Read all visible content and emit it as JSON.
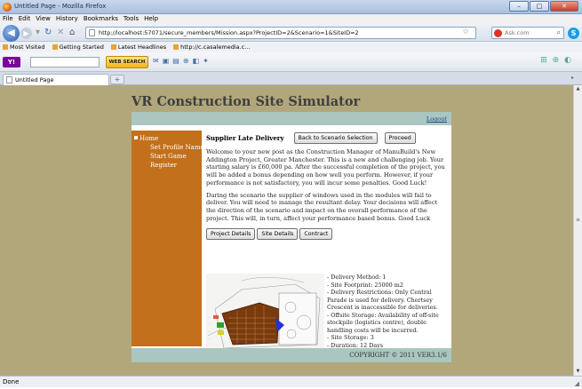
{
  "browser": {
    "window_title": "Untitled Page - Mozilla Firefox",
    "menu": [
      "File",
      "Edit",
      "View",
      "History",
      "Bookmarks",
      "Tools",
      "Help"
    ],
    "url": "http://localhost:57071/secure_members/Mission.aspx?ProjectID=2&Scenario=1&SiteID=2",
    "search_placeholder": "Ask.com",
    "bookmarks": [
      "Most Visited",
      "Getting Started",
      "Latest Headlines",
      "http://c.casalemedia.c..."
    ],
    "web_search_label": "WEB SEARCH",
    "tab_title": "Untitled Page",
    "status": "Done"
  },
  "page": {
    "site_title": "VR Construction Site Simulator",
    "logout": "Logout",
    "nav": [
      "Home",
      "Set Profile Name",
      "Start Game",
      "Register"
    ],
    "subtitle": "Supplier Late Delivery",
    "back_button": "Back to Scenario Selection",
    "proceed_button": "Proceed",
    "intro": "Welcome to your new post as the Construction Manager of ManuBuild's New Addington Project, Greater Manchester. This is a new and challenging job. Your starting salary is £60,000 pa. After the successful completion of the project, you will be added a bonus depending on how well you perform. However, if your performance is not satisfactory, you will incur some penalties. Good Luck!",
    "scenario": "During the scenario the supplier of windows used in the modules will fail to deliver. You will need to manage the resultant delay. Your decisions will affect the direction of the scenario and impact on the overall performance of the project. This will, in turn, affect your performance based bonus. Good Luck",
    "tabs": [
      "Project Details",
      "Site Details",
      "Contract"
    ],
    "details": [
      "- Delivery Method: 1",
      "- Site Footprint: 25000 m2",
      "- Delivery Restrictions: Only Central Parade is used for delivery. Chertsey Crescent is inaccessible for deliveries.",
      "- Offsite Storage: Availability of off-site stockpile (logistics centre), double handling costs will be incurred.",
      "- Site Storage: 3",
      "- Duration: 12 Days"
    ],
    "copyright": "COPYRIGHT © 2011 VER3.1/6"
  },
  "colors": {
    "page_bg": "#b1a77b",
    "sidebar": "#c2701b",
    "header_bar": "#aac6c0",
    "title_text": "#3f3f3f"
  }
}
